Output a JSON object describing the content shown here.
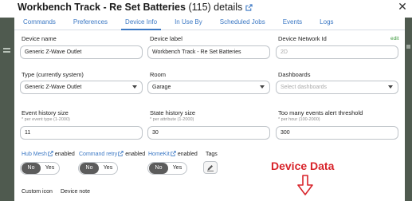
{
  "dialog": {
    "title_name": "Workbench Track - Re Set Batteries",
    "title_count": " (115)",
    "title_suffix": " details"
  },
  "tabs": [
    "Commands",
    "Preferences",
    "Device Info",
    "In Use By",
    "Scheduled Jobs",
    "Events",
    "Logs"
  ],
  "active_tab": "Device Info",
  "fields": {
    "device_name": {
      "label": "Device name",
      "value": "Generic Z-Wave Outlet"
    },
    "device_label": {
      "label": "Device label",
      "value": "Workbench Track - Re Set Batteries"
    },
    "network_id": {
      "label": "Device Network Id",
      "edit": "edit",
      "value": "2D"
    },
    "type": {
      "label": "Type (currently system)",
      "value": "Generic Z-Wave Outlet"
    },
    "room": {
      "label": "Room",
      "value": "Garage"
    },
    "dashboards": {
      "label": "Dashboards",
      "placeholder": "Select dashboards"
    },
    "event_history": {
      "label": "Event history size",
      "help": "* per event type (1-2000)",
      "value": "11"
    },
    "state_history": {
      "label": "State history size",
      "help": "* per attribute (1-2000)",
      "value": "30"
    },
    "too_many_events": {
      "label": "Too many events alert threshold",
      "help": "* per hour (100-2000)",
      "value": "300"
    }
  },
  "options": {
    "hub_mesh": {
      "link": "Hub Mesh",
      "status": "enabled"
    },
    "command_retry": {
      "link": "Command retry",
      "status": "enabled"
    },
    "homekit": {
      "link": "HomeKit",
      "status": "enabled"
    },
    "tags": {
      "label": "Tags"
    },
    "toggle_no": "No",
    "toggle_yes": "Yes"
  },
  "bottom": {
    "custom_icon": "Custom icon",
    "device_note": "Device note"
  },
  "annotation": {
    "text": "Device Data",
    "color": "#d8232a"
  },
  "colors": {
    "link": "#3b78c4",
    "edit": "#3e9a3e",
    "toggle_active": "#5c5c5c",
    "backdrop": "#4f5a4f"
  },
  "icons": [
    "external-link-icon",
    "close-icon",
    "chevron-down-icon",
    "tag-edit-icon",
    "down-arrow-icon"
  ]
}
